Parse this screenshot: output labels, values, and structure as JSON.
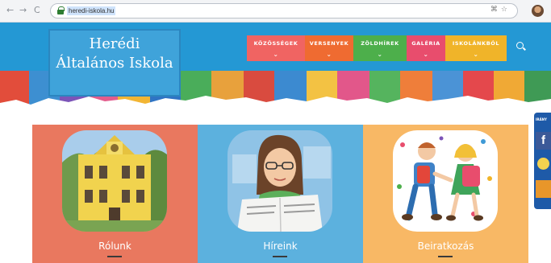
{
  "browser": {
    "url": "heredi-iskola.hu",
    "nav_back": "←",
    "nav_forward": "→",
    "reload": "C",
    "url_icons": "⌘☆"
  },
  "site": {
    "logo_line1": "Herédi",
    "logo_line2": "Általános Iskola"
  },
  "menu": [
    {
      "label": "KÖZÖSSÉGEK",
      "color": "#f06462"
    },
    {
      "label": "VERSENYEK",
      "color": "#ef6b31"
    },
    {
      "label": "ZÖLDHÍREK",
      "color": "#4daf4b"
    },
    {
      "label": "GALÉRIA",
      "color": "#e84d6d"
    },
    {
      "label": "ISKOLÁNKBÓL",
      "color": "#f0b429"
    }
  ],
  "chevron": "⌄",
  "cards": [
    {
      "label": "Rólunk",
      "color": "#e9785f"
    },
    {
      "label": "Híreink",
      "color": "#5cb1de"
    },
    {
      "label": "Beiratkozás",
      "color": "#f8b865"
    }
  ],
  "social": {
    "top_text": "IRÁNY",
    "facebook": "f"
  }
}
